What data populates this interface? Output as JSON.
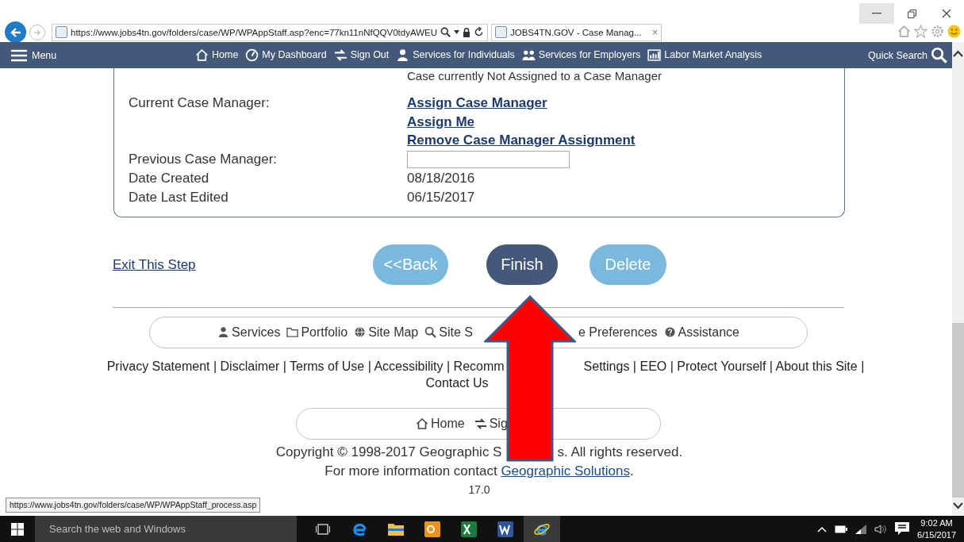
{
  "browser": {
    "address": "https://www.jobs4tn.gov/folders/case/WP/WPAppStaff.asp?enc=77kn11nNfQQV0tdyAWEU",
    "tab_title": "JOBS4TN.GOV - Case Manag...",
    "tab_close": "×"
  },
  "nav": {
    "menu": "Menu",
    "items": [
      {
        "label": "Home",
        "kind": "home"
      },
      {
        "label": "My Dashboard",
        "kind": "dashboard"
      },
      {
        "label": "Sign Out",
        "kind": "signout"
      },
      {
        "label": "Services for Individuals",
        "kind": "person"
      },
      {
        "label": "Services for Employers",
        "kind": "people"
      },
      {
        "label": "Labor Market Analysis",
        "kind": "chart"
      }
    ],
    "quick_search": "Quick Search"
  },
  "case": {
    "status_note": "Case currently Not Assigned to a Case Manager",
    "rows": [
      {
        "label": "Current Case Manager:",
        "kind": "links",
        "links": [
          "Assign Case Manager",
          "Assign Me",
          "Remove Case Manager Assignment"
        ]
      },
      {
        "label": "Previous Case Manager:",
        "kind": "input"
      },
      {
        "label": "Date Created",
        "kind": "text",
        "value": "08/18/2016"
      },
      {
        "label": "Date Last Edited",
        "kind": "text",
        "value": "06/15/2017"
      }
    ]
  },
  "actions": {
    "exit_link": "Exit This Step",
    "buttons": [
      {
        "label": "<<Back",
        "kind": "secondary"
      },
      {
        "label": "Finish",
        "kind": "primary"
      },
      {
        "label": "Delete",
        "kind": "secondary"
      }
    ]
  },
  "footer": {
    "nav_items": [
      {
        "label": "Services",
        "kind": "person"
      },
      {
        "label": "Portfolio",
        "kind": "folder"
      },
      {
        "label": "Site Map",
        "kind": "globe"
      },
      {
        "label": "Site S",
        "kind": "search"
      },
      {
        "label": "e Preferences",
        "kind": "plain"
      },
      {
        "label": "Assistance",
        "kind": "help"
      }
    ],
    "legal_lines": [
      [
        "Privacy Statement | Disclaimer | Terms of Use | Accessibility | Recomm",
        "Settings | EEO | Protect Yourself | About this Site |"
      ],
      [
        "Contact Us"
      ]
    ],
    "bottom_nav": [
      {
        "label": "Home",
        "kind": "home"
      },
      {
        "label": "Sig",
        "kind": "signout"
      }
    ],
    "copyright": [
      "Copyright © 1998-2017 Geographic S",
      "s. All rights reserved."
    ],
    "contact": {
      "text": "For more information contact",
      "link": "Geographic Solutions",
      "after": "."
    },
    "version": "17.0"
  },
  "status_url": "https://www.jobs4tn.gov/folders/case/WP/WPAppStaff_process.asp",
  "taskbar": {
    "search_placeholder": "Search the web and Windows",
    "time": "9:02 AM",
    "date": "6/15/2017"
  }
}
